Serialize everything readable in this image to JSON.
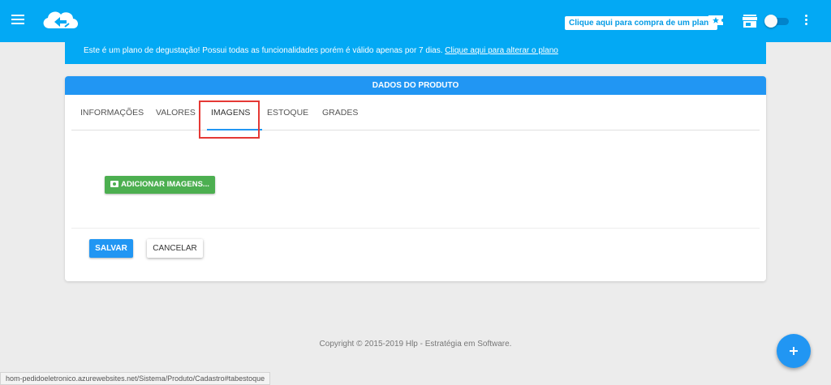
{
  "topbar": {
    "menu_icon": "hamburger-menu-icon",
    "logo_icon": "cloud-arrows-logo",
    "buy_plan_label": "Clique aqui para compra de um plano",
    "ticket_icon": "ticket-star-icon",
    "store_icon": "store-icon",
    "more_icon": "more-vert-icon",
    "accent_color": "#03a9f4"
  },
  "banner": {
    "text": "Este é um plano de degustação! Possui todas as funcionalidades porém é válido apenas por 7 dias.",
    "link": "Clique aqui para alterar o plano"
  },
  "card": {
    "title": "DADOS DO PRODUTO",
    "tabs": [
      {
        "label": "INFORMAÇÕES"
      },
      {
        "label": "VALORES"
      },
      {
        "label": "IMAGENS"
      },
      {
        "label": "ESTOQUE"
      },
      {
        "label": "GRADES"
      }
    ],
    "active_tab": "IMAGENS",
    "add_images_label": "ADICIONAR IMAGENS...",
    "save_label": "SALVAR",
    "cancel_label": "CANCELAR"
  },
  "footer": {
    "copyright": "Copyright © 2015-2019 Hlp - Estratégia em Software."
  },
  "status_bar": {
    "url": "hom-pedidoeletronico.azurewebsites.net/Sistema/Produto/Cadastro#tabestoque"
  },
  "fab": {
    "icon": "plus-icon"
  }
}
